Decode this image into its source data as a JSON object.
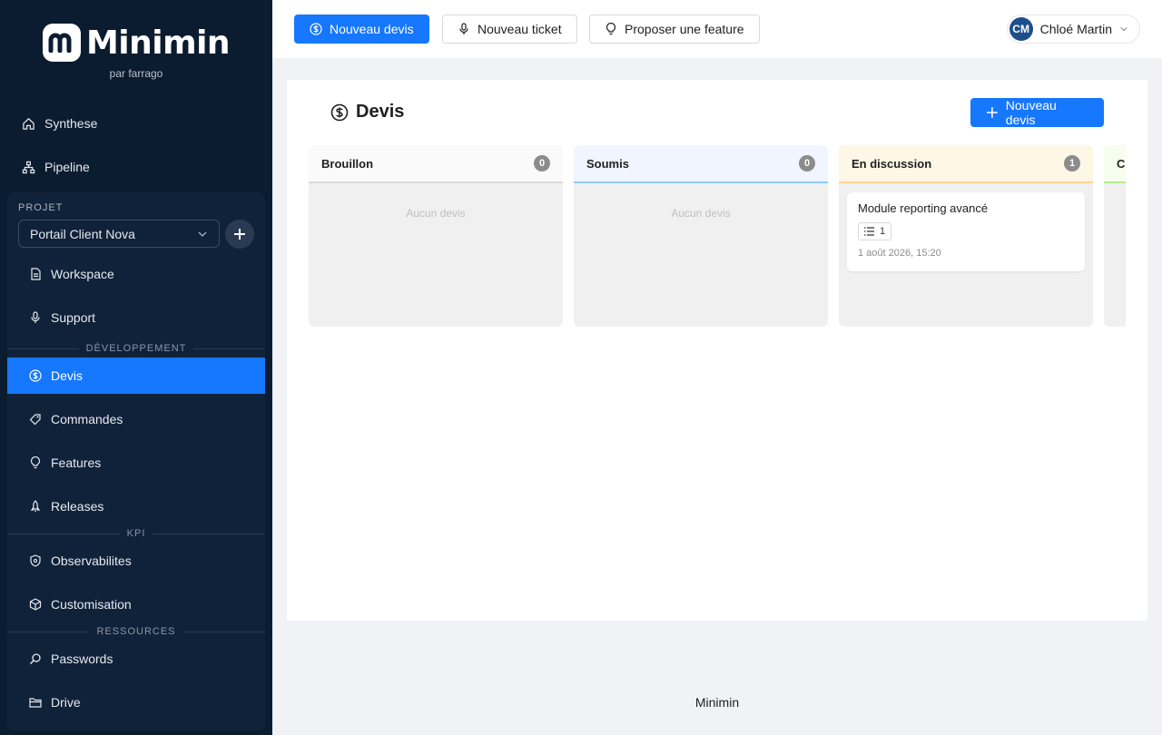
{
  "brand": {
    "name": "Minimin",
    "subtitle": "par farrago"
  },
  "sidebar": {
    "top_items": [
      {
        "label": "Synthese",
        "icon": "home-icon"
      },
      {
        "label": "Pipeline",
        "icon": "sitemap-icon"
      }
    ],
    "project": {
      "section_label": "PROJET",
      "selected": "Portail Client Nova"
    },
    "items": [
      {
        "label": "Workspace",
        "icon": "file-icon"
      },
      {
        "label": "Support",
        "icon": "microphone-icon"
      },
      {
        "label": "Devis",
        "icon": "dollar-circle-icon",
        "active": true
      },
      {
        "label": "Commandes",
        "icon": "tag-icon"
      },
      {
        "label": "Features",
        "icon": "bulb-icon"
      },
      {
        "label": "Releases",
        "icon": "rocket-icon"
      },
      {
        "label": "Observabilites",
        "icon": "shield-icon"
      },
      {
        "label": "Customisation",
        "icon": "cube-icon"
      },
      {
        "label": "Passwords",
        "icon": "search-icon"
      },
      {
        "label": "Drive",
        "icon": "folder-icon"
      }
    ],
    "sections": {
      "dev": "DÉVELOPPEMENT",
      "kpi": "KPI",
      "resources": "RESSOURCES"
    }
  },
  "topbar": {
    "new_quote": "Nouveau devis",
    "new_ticket": "Nouveau ticket",
    "propose_feature": "Proposer une feature",
    "user": {
      "initials": "CM",
      "name": "Chloé Martin"
    }
  },
  "main": {
    "title": "Devis",
    "new_button": "Nouveau devis",
    "columns": [
      {
        "name": "Brouillon",
        "count": "0",
        "empty_text": "Aucun devis",
        "accent": "#d9d9d9",
        "head_bg": "#fafafa"
      },
      {
        "name": "Soumis",
        "count": "0",
        "empty_text": "Aucun devis",
        "accent": "#91caff",
        "head_bg": "#f0f5ff"
      },
      {
        "name": "En discussion",
        "count": "1",
        "accent": "#ffd591",
        "head_bg": "#fff7e6",
        "cards": [
          {
            "title": "Module reporting avancé",
            "items": "1",
            "date": "1 août 2026, 15:20"
          }
        ]
      },
      {
        "name": "C",
        "count": "",
        "accent": "#b7eb8f",
        "head_bg": "#f6ffed"
      }
    ]
  },
  "footer": {
    "text": "Minimin"
  },
  "colors": {
    "sidebar_bg": "#0c1c30",
    "primary": "#1677ff"
  }
}
